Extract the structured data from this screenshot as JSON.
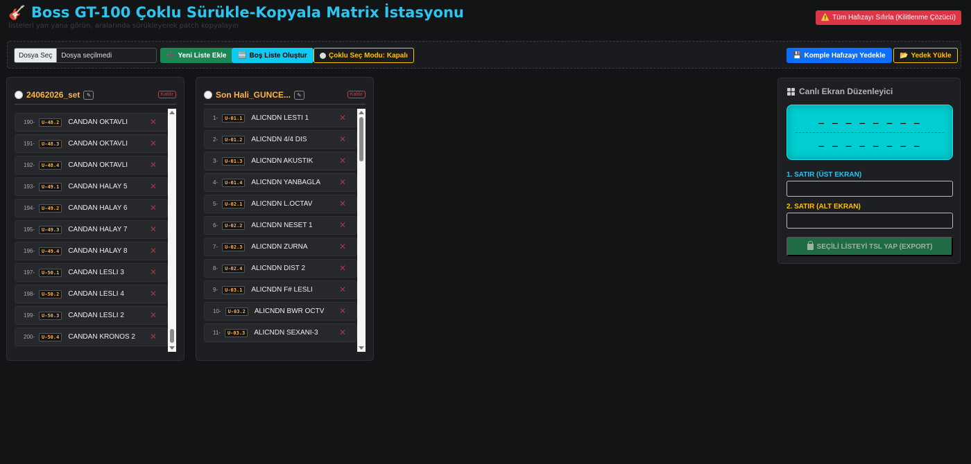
{
  "header": {
    "title": "Boss GT-100 Çoklu Sürükle-Kopyala Matrix İstasyonu",
    "subtitle": "listeleri yan yana görün, aralarında sürükleyerek patch kopyalayın",
    "reset_label": "Tüm Hafızayı Sıfırla (Kilitlenme Çözücü)"
  },
  "toolbar": {
    "file_button": "Dosya Seç",
    "file_name": "Dosya seçilmedi",
    "add_list": "Yeni Liste Ekle",
    "empty_list": "Boş Liste Oluştur",
    "multi_select": "Çoklu Seç Modu: Kapalı",
    "backup": "Komple Hafızayı Yedekle",
    "load_backup": "Yedek Yükle"
  },
  "lists": [
    {
      "title": "24062026_set",
      "remove_label": "Kaldır",
      "rows": [
        {
          "num": "190-",
          "code": "U-48.2",
          "name": "CANDAN OKTAVLI"
        },
        {
          "num": "191-",
          "code": "U-48.3",
          "name": "CANDAN OKTAVLI"
        },
        {
          "num": "192-",
          "code": "U-48.4",
          "name": "CANDAN OKTAVLI"
        },
        {
          "num": "193-",
          "code": "U-49.1",
          "name": "CANDAN HALAY 5"
        },
        {
          "num": "194-",
          "code": "U-49.2",
          "name": "CANDAN HALAY 6"
        },
        {
          "num": "195-",
          "code": "U-49.3",
          "name": "CANDAN HALAY 7"
        },
        {
          "num": "196-",
          "code": "U-49.4",
          "name": "CANDAN HALAY 8"
        },
        {
          "num": "197-",
          "code": "U-50.1",
          "name": "CANDAN LESLI 3"
        },
        {
          "num": "198-",
          "code": "U-50.2",
          "name": "CANDAN LESLI 4"
        },
        {
          "num": "199-",
          "code": "U-50.3",
          "name": "CANDAN LESLI 2"
        },
        {
          "num": "200-",
          "code": "U-50.4",
          "name": "CANDAN KRONOS 2"
        }
      ]
    },
    {
      "title": "Son Hali_GUNCE...",
      "remove_label": "Kaldır",
      "rows": [
        {
          "num": "1-",
          "code": "U-01.1",
          "name": "ALICNDN LESTI 1"
        },
        {
          "num": "2-",
          "code": "U-01.2",
          "name": "ALICNDN 4/4 DIS"
        },
        {
          "num": "3-",
          "code": "U-01.3",
          "name": "ALICNDN AKUSTIK"
        },
        {
          "num": "4-",
          "code": "U-01.4",
          "name": "ALICNDN YANBAGLA"
        },
        {
          "num": "5-",
          "code": "U-02.1",
          "name": "ALICNDN L.OCTAV"
        },
        {
          "num": "6-",
          "code": "U-02.2",
          "name": "ALICNDN NESET 1"
        },
        {
          "num": "7-",
          "code": "U-02.3",
          "name": "ALICNDN ZURNA"
        },
        {
          "num": "8-",
          "code": "U-02.4",
          "name": "ALICNDN DIST 2"
        },
        {
          "num": "9-",
          "code": "U-03.1",
          "name": "ALICNDN F# LESLI"
        },
        {
          "num": "10-",
          "code": "U-03.2",
          "name": "ALICNDN BWR OCTV"
        },
        {
          "num": "11-",
          "code": "U-03.3",
          "name": "ALICNDN SEXANI-3"
        }
      ]
    }
  ],
  "editor": {
    "title": "Canlı Ekran Düzenleyici",
    "lcd_line1": "_ _ _ _ _ _ _ _",
    "lcd_line2": "_ _ _ _ _ _ _ _",
    "label_line1": "1. SATIR (ÜST EKRAN)",
    "label_line2": "2. SATIR (ALT EKRAN)",
    "value_line1": "",
    "value_line2": "",
    "export_label": "SEÇİLİ LİSTEYİ TSL YAP (EXPORT)"
  },
  "colors": {
    "accent_title": "#2ec4f0",
    "list_title": "#ffb347",
    "danger": "#dc3545",
    "lcd": "#00ced1"
  },
  "icons": {
    "title": "guitar-icon",
    "reset": "warning-icon",
    "add_list": "plus-icon",
    "empty_list": "new-icon",
    "multi_select": "circle-icon",
    "backup": "save-icon",
    "load_backup": "folder-icon",
    "editor": "grid-icon",
    "export": "lock-icon",
    "row_delete": "close-icon",
    "list_edit": "pencil-icon"
  }
}
